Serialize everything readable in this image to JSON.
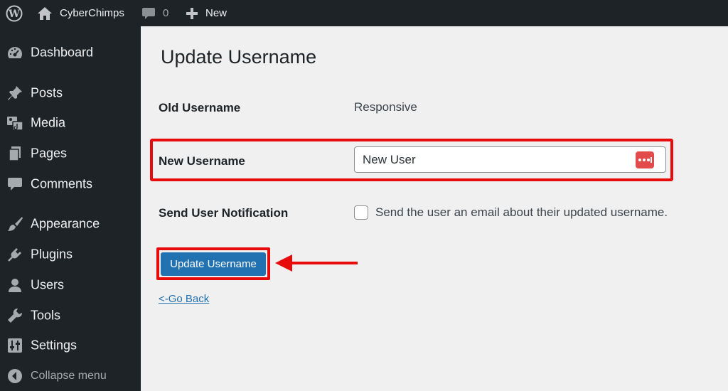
{
  "adminbar": {
    "site_name": "CyberChimps",
    "comment_count": "0",
    "new_label": "New"
  },
  "sidebar": {
    "items": [
      {
        "label": "Dashboard",
        "icon": "dashboard-icon"
      },
      {
        "label": "Posts",
        "icon": "pin-icon"
      },
      {
        "label": "Media",
        "icon": "media-icon"
      },
      {
        "label": "Pages",
        "icon": "pages-icon"
      },
      {
        "label": "Comments",
        "icon": "comment-icon"
      },
      {
        "label": "Appearance",
        "icon": "brush-icon"
      },
      {
        "label": "Plugins",
        "icon": "plug-icon"
      },
      {
        "label": "Users",
        "icon": "user-icon"
      },
      {
        "label": "Tools",
        "icon": "wrench-icon"
      },
      {
        "label": "Settings",
        "icon": "sliders-icon"
      }
    ],
    "collapse_label": "Collapse menu"
  },
  "main": {
    "title": "Update Username",
    "old_username_label": "Old Username",
    "old_username_value": "Responsive",
    "new_username_label": "New Username",
    "new_username_value": "New User",
    "notify_label": "Send User Notification",
    "notify_checkbox_text": "Send the user an email about their updated username.",
    "notify_checked": false,
    "submit_label": "Update Username",
    "back_link": "<-Go Back"
  },
  "colors": {
    "admin_dark": "#1d2327",
    "primary_blue": "#2271b1",
    "highlight_red": "#e80b0b",
    "background": "#f0f0f1"
  }
}
